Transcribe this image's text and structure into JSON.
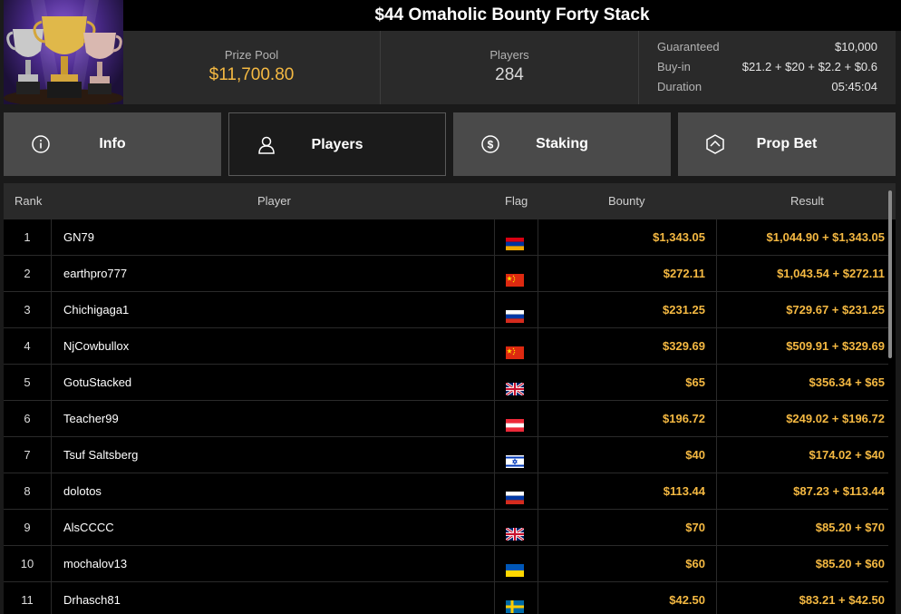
{
  "tournament": {
    "title": "$44 Omaholic Bounty Forty Stack"
  },
  "stats": {
    "prize_pool_label": "Prize Pool",
    "prize_pool_value": "$11,700.80",
    "players_label": "Players",
    "players_value": "284",
    "guaranteed_label": "Guaranteed",
    "guaranteed_value": "$10,000",
    "buyin_label": "Buy-in",
    "buyin_value": "$21.2 + $20 + $2.2 + $0.6",
    "duration_label": "Duration",
    "duration_value": "05:45:04"
  },
  "tabs": [
    {
      "label": "Info",
      "icon": "info-icon",
      "active": false
    },
    {
      "label": "Players",
      "icon": "user-icon",
      "active": true
    },
    {
      "label": "Staking",
      "icon": "coin-dollar-icon",
      "active": false
    },
    {
      "label": "Prop Bet",
      "icon": "prop-bet-icon",
      "active": false
    }
  ],
  "table": {
    "headers": {
      "rank": "Rank",
      "player": "Player",
      "flag": "Flag",
      "bounty": "Bounty",
      "result": "Result"
    },
    "rows": [
      {
        "rank": "1",
        "player": "GN79",
        "flag": "armenia-flag",
        "bounty": "$1,343.05",
        "result": "$1,044.90 + $1,343.05"
      },
      {
        "rank": "2",
        "player": "earthpro777",
        "flag": "china-flag",
        "bounty": "$272.11",
        "result": "$1,043.54 + $272.11"
      },
      {
        "rank": "3",
        "player": "Chichigaga1",
        "flag": "russia-flag",
        "bounty": "$231.25",
        "result": "$729.67 + $231.25"
      },
      {
        "rank": "4",
        "player": "NjCowbullox",
        "flag": "china-flag",
        "bounty": "$329.69",
        "result": "$509.91 + $329.69"
      },
      {
        "rank": "5",
        "player": "GotuStacked",
        "flag": "uk-flag",
        "bounty": "$65",
        "result": "$356.34 + $65"
      },
      {
        "rank": "6",
        "player": "Teacher99",
        "flag": "austria-flag",
        "bounty": "$196.72",
        "result": "$249.02 + $196.72"
      },
      {
        "rank": "7",
        "player": "Tsuf Saltsberg",
        "flag": "israel-flag",
        "bounty": "$40",
        "result": "$174.02 + $40"
      },
      {
        "rank": "8",
        "player": "dolotos",
        "flag": "russia-flag",
        "bounty": "$113.44",
        "result": "$87.23 + $113.44"
      },
      {
        "rank": "9",
        "player": "AlsCCCC",
        "flag": "uk-flag",
        "bounty": "$70",
        "result": "$85.20 + $70"
      },
      {
        "rank": "10",
        "player": "mochalov13",
        "flag": "ukraine-flag",
        "bounty": "$60",
        "result": "$85.20 + $60"
      },
      {
        "rank": "11",
        "player": "Drhasch81",
        "flag": "sweden-flag",
        "bounty": "$42.50",
        "result": "$83.21 + $42.50"
      }
    ]
  },
  "colors": {
    "accent_gold": "#f5b942",
    "tab_bg": "#4a4a4a",
    "active_tab_bg": "#1b1b1b"
  }
}
